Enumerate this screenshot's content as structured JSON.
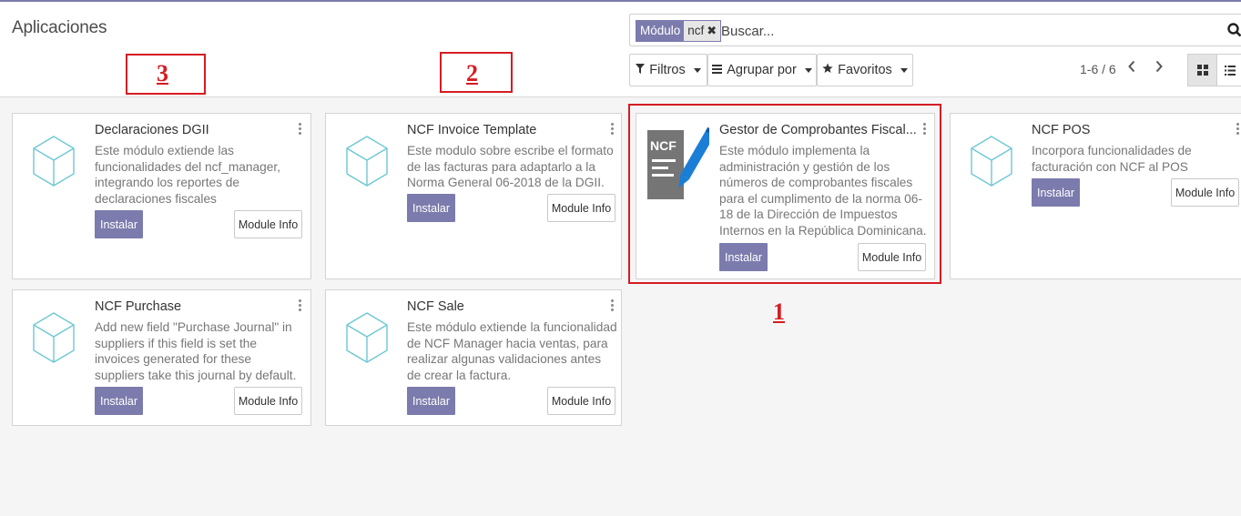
{
  "colors": {
    "primary": "#7c7bad",
    "annotation": "#d51c23"
  },
  "breadcrumb": "Aplicaciones",
  "search": {
    "facet_label": "Módulo",
    "facet_value": "ncf",
    "placeholder": "Buscar...",
    "icon": "search-icon"
  },
  "toolbar": {
    "filters": "Filtros",
    "group_by": "Agrupar por",
    "favorites": "Favoritos"
  },
  "pager": {
    "value": "1-6 / 6"
  },
  "annotations": [
    "1",
    "2",
    "3"
  ],
  "apps": [
    {
      "name": "Declaraciones DGII",
      "description": "Este módulo extiende las funcionalidades del ncf_manager, integrando los reportes de declaraciones fiscales",
      "install": "Instalar",
      "info": "Module Info",
      "icon": "module-cube-icon"
    },
    {
      "name": "NCF Invoice Template",
      "description": "Este modulo sobre escribe el formato de las facturas para adaptarlo a la Norma General 06-2018 de la DGII.",
      "install": "Instalar",
      "info": "Module Info",
      "icon": "module-cube-icon"
    },
    {
      "name": "Gestor de Comprobantes Fiscal...",
      "description": "Este módulo implementa la administración y gestión de los números de comprobantes fiscales para el cumplimento de la norma 06-18 de la Dirección de Impuestos Internos en la República Dominicana.",
      "install": "Instalar",
      "info": "Module Info",
      "icon": "ncf-document-icon",
      "icon_text": "NCF"
    },
    {
      "name": "NCF POS",
      "description": "Incorpora funcionalidades de facturación con NCF al POS",
      "install": "Instalar",
      "info": "Module Info",
      "icon": "module-cube-icon"
    },
    {
      "name": "NCF Purchase",
      "description": "Add new field \"Purchase Journal\" in suppliers if this field is set the invoices generated for these suppliers take this journal by default.",
      "install": "Instalar",
      "info": "Module Info",
      "icon": "module-cube-icon"
    },
    {
      "name": "NCF Sale",
      "description": "Este módulo extiende la funcionalidad de NCF Manager hacia ventas, para realizar algunas validaciones antes de crear la factura.",
      "install": "Instalar",
      "info": "Module Info",
      "icon": "module-cube-icon"
    }
  ]
}
